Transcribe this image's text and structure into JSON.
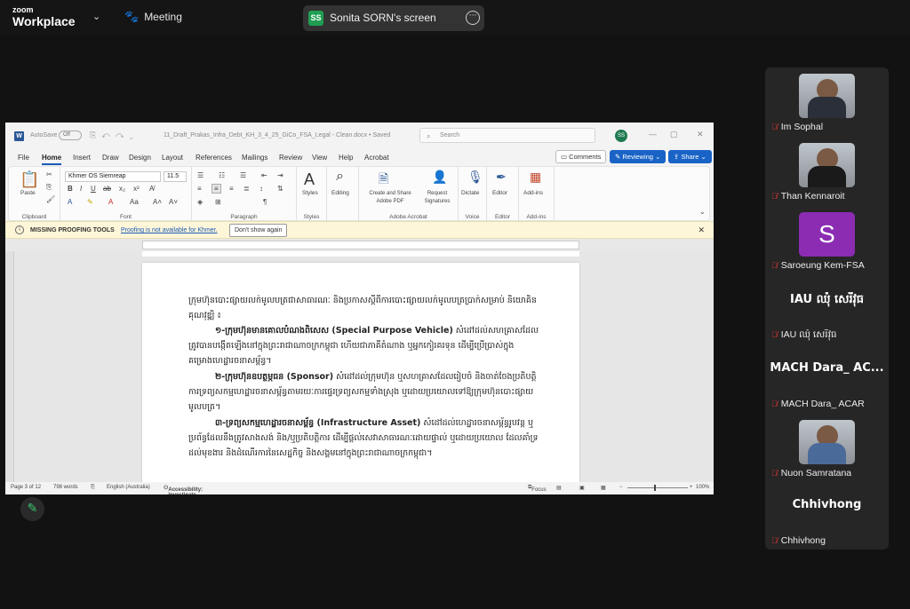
{
  "app": {
    "logo_top": "zoom",
    "logo_bottom": "Workplace",
    "meeting_label": "Meeting",
    "share_initials": "SS",
    "share_label": "Sonita SORN's screen"
  },
  "word": {
    "autosave": "AutoSave",
    "toggle": "Off",
    "filename": "11_Draft_Prakas_Infra_Debt_KH_3_4_25_GiCo_FSA_Legal - Clean.docx • Saved",
    "search_placeholder": "Search",
    "user_initials": "SS",
    "menu": [
      "File",
      "Home",
      "Insert",
      "Draw",
      "Design",
      "Layout",
      "References",
      "Mailings",
      "Review",
      "View",
      "Help",
      "Acrobat"
    ],
    "comments": "Comments",
    "reviewing": "Reviewing",
    "share": "Share",
    "ribbon": {
      "paste": "Paste",
      "clipboard": "Clipboard",
      "font_name": "Khmer OS Siemreap",
      "font_size": "11.5",
      "font": "Font",
      "paragraph": "Paragraph",
      "styles": "Styles",
      "styles_group": "Styles",
      "editing": "Editing",
      "create_share": "Create and Share Adobe PDF",
      "request_sig": "Request Signatures",
      "adobe_acrobat": "Adobe Acrobat",
      "dictate": "Dictate",
      "voice": "Voice",
      "editor": "Editor",
      "editor_group": "Editor",
      "addins": "Add-ins",
      "addins_group": "Add-ins"
    },
    "message_bar": {
      "title": "MISSING PROOFING TOOLS",
      "link": "Proofing is not available for Khmer.",
      "button": "Don't show again"
    },
    "document": {
      "p1": "ក្រុមហ៊ុនបោះផ្សាយលក់មូលបត្រជាសាធារណៈ និងប្រកាសស្តីពីការបោះផ្សាយលក់មូលបត្រប្រាក់សម្រាប់ និយោគិនគុណវុឌ្ឍិ ៖",
      "p2_term": "១-ក្រុមហ៊ុនមានគោលបំណងពិសេស (Special Purpose Vehicle)",
      "p2_rest": " សំដៅដល់សហគ្រាសដែលត្រូវបានបង្កើតឡើងនៅក្នុងព្រះរាជាណាចក្រកម្ពុជា ហើយជាភាគីតំណាង ឬអ្នកកៀរគរទុន ដើម្បីប្រើប្រាស់ក្នុងគម្រោងហេដ្ឋារចនាសម្ព័ន្ធ។",
      "p3_term": "២-ក្រុមហ៊ុនឧបត្ថម្ភធន (Sponsor)",
      "p3_rest": " សំដៅដល់ក្រុមហ៊ុន ឬសហគ្រាសដែលរៀបចំ និងចាត់ចែងប្រតិបត្តិការទ្រព្យសកម្មហេដ្ឋារចនាសម្ព័ន្ធតាមរយៈការផ្ទេរទ្រព្យសកម្មទាំងស្រុង ឬដោយប្រយោលទៅឱ្យក្រុមហ៊ុនបោះផ្សាយមូលបត្រ។",
      "p4_term": "៣-ទ្រព្យសកម្មហេដ្ឋារចនាសម្ព័ន្ធ (Infrastructure Asset)",
      "p4_rest": " សំដៅដល់ហេដ្ឋារចនាសម្ព័ន្ធរូបវន្ត ឬប្រព័ន្ធដែលនឹងត្រូវសាងសង់ និង/ឬប្រតិបត្តិការ ដើម្បីផ្តល់សេវាសាធារណៈដោយផ្ទាល់ ឬដោយប្រយោល ដែលគាំទ្រដល់មុខងារ និងដំណើរការនៃសេដ្ឋកិច្ច និងសង្គមនៅក្នុងព្រះរាជាណាចក្រកម្ពុជា។"
    },
    "status": {
      "page": "Page 3 of 12",
      "words": "798 words",
      "language": "English (Australia)",
      "accessibility": "Accessibility: Investigate",
      "focus": "Focus",
      "zoom": "100%"
    }
  },
  "participants": [
    {
      "name": "Im Sophal",
      "type": "photo"
    },
    {
      "name": "Than Kennaroit",
      "type": "photo"
    },
    {
      "name": "Saroeung Kem-FSA",
      "type": "initial",
      "initial": "S"
    },
    {
      "name": "IAU ឈុំ សេរីវុធ",
      "type": "text",
      "display": "IAU ឈុំ សេរីវុធ"
    },
    {
      "name": "MACH Dara_ ACAR",
      "type": "text",
      "display": "MACH Dara_ AC..."
    },
    {
      "name": "Nuon Samratana",
      "type": "photo"
    },
    {
      "name": "Chhivhong",
      "type": "text",
      "display": "Chhivhong"
    }
  ],
  "colors": {
    "accent": "#1a63c6",
    "share_green": "#1f9e52",
    "muted_red": "#e33333",
    "purple_avatar": "#8b2cb3"
  }
}
